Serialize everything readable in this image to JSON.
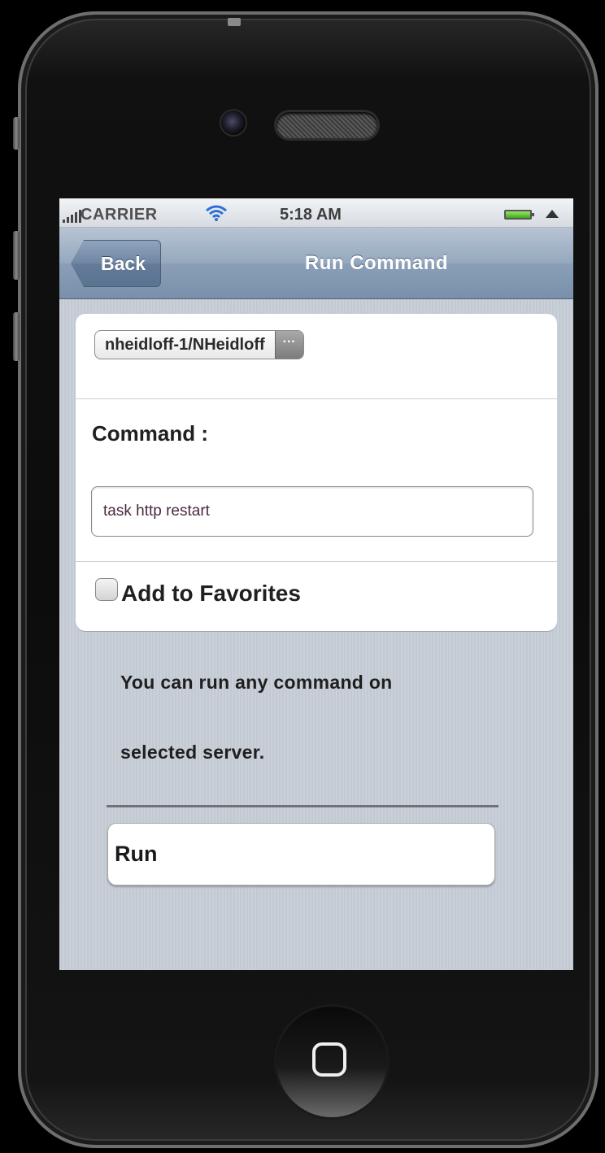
{
  "status_bar": {
    "carrier": "CARRIER",
    "time": "5:18 AM"
  },
  "nav": {
    "back_label": "Back",
    "title": "Run Command"
  },
  "form": {
    "server": "nheidloff-1/NHeidloff",
    "more_label": "···",
    "command_label": "Command :",
    "command_value": "task http restart",
    "favorites_label": "Add to Favorites",
    "favorites_checked": false
  },
  "help": {
    "line1": "You can run any command on",
    "line2": "selected server."
  },
  "actions": {
    "run_label": "Run"
  },
  "icons": {
    "signal": "signal-bars-icon",
    "wifi": "wifi-icon",
    "battery": "battery-icon",
    "location": "location-arrow-icon",
    "more": "ellipsis-icon",
    "home": "home-button-icon",
    "camera": "front-camera-icon",
    "speaker": "earpiece-speaker-icon"
  },
  "colors": {
    "nav_bar": "#8a9fb7",
    "screen_background": "#c6cdd6",
    "battery_fill": "#3caa1a",
    "device_body": "#0c0c0c"
  }
}
